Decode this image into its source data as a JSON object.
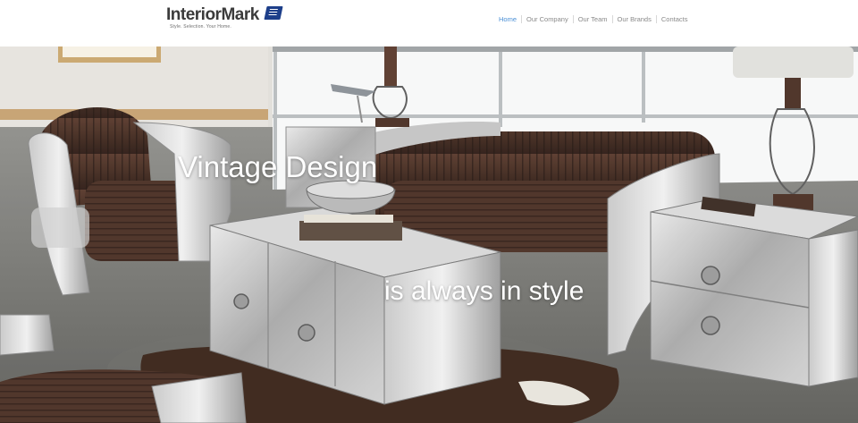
{
  "header": {
    "logo_text": "InteriorMark",
    "logo_tagline": "Style. Selection. Your Home.",
    "nav": [
      {
        "label": "Home",
        "active": true
      },
      {
        "label": "Our Company",
        "active": false
      },
      {
        "label": "Our Team",
        "active": false
      },
      {
        "label": "Our Brands",
        "active": false
      },
      {
        "label": "Contacts",
        "active": false
      }
    ]
  },
  "hero": {
    "headline": "Vintage Design",
    "subheadline": "is always in style"
  },
  "colors": {
    "nav_active": "#4a8fd6",
    "nav_inactive": "#8a8a8a",
    "logo_text": "#3b3b3b",
    "logo_badge": "#1d3f8a",
    "hero_text": "#ffffff"
  }
}
